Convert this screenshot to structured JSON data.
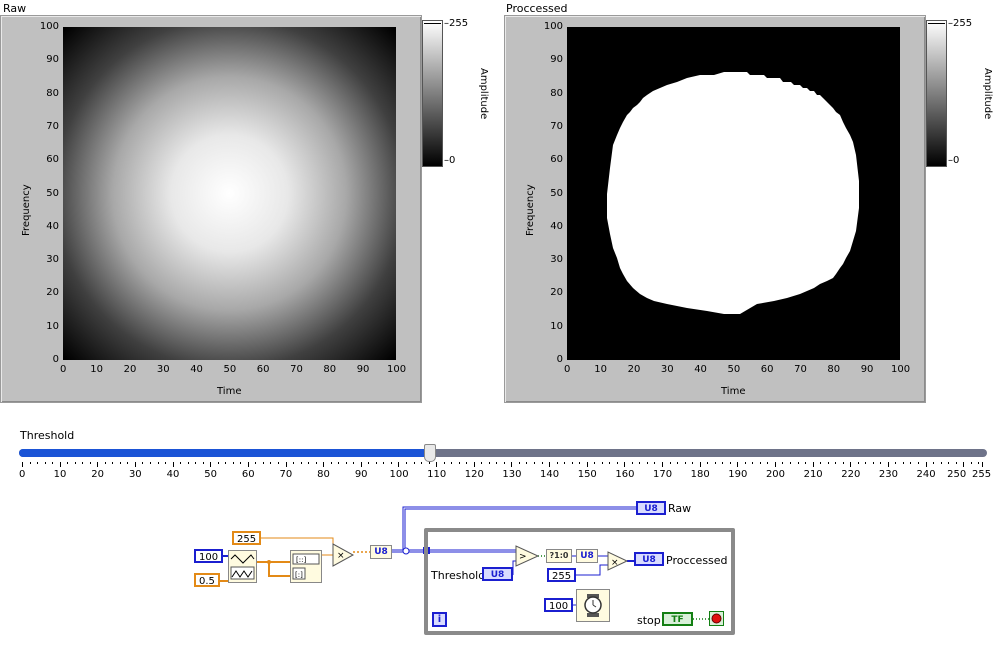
{
  "graphs": [
    {
      "title": "Raw",
      "x_axis_label": "Time",
      "y_axis_label": "Frequency",
      "x_ticks": [
        "0",
        "10",
        "20",
        "30",
        "40",
        "50",
        "60",
        "70",
        "80",
        "90",
        "100"
      ],
      "y_ticks": [
        "100",
        "90",
        "80",
        "70",
        "60",
        "50",
        "40",
        "30",
        "20",
        "10",
        "0"
      ],
      "colorbar_label": "Amplitude",
      "colorbar_max": "255",
      "colorbar_min": "0"
    },
    {
      "title": "Proccessed",
      "x_axis_label": "Time",
      "y_axis_label": "Frequency",
      "x_ticks": [
        "0",
        "10",
        "20",
        "30",
        "40",
        "50",
        "60",
        "70",
        "80",
        "90",
        "100"
      ],
      "y_ticks": [
        "100",
        "90",
        "80",
        "70",
        "60",
        "50",
        "40",
        "30",
        "20",
        "10",
        "0"
      ],
      "colorbar_label": "Amplitude",
      "colorbar_max": "255",
      "colorbar_min": "0"
    }
  ],
  "slider": {
    "label": "Threshold",
    "value": 108,
    "min": 0,
    "max": 255,
    "ticks": [
      "0",
      "10",
      "20",
      "30",
      "40",
      "50",
      "60",
      "70",
      "80",
      "90",
      "100",
      "110",
      "120",
      "130",
      "140",
      "150",
      "160",
      "170",
      "180",
      "190",
      "200",
      "210",
      "220",
      "230",
      "240",
      "250",
      "255"
    ]
  },
  "diagram": {
    "const_100_a": "100",
    "const_05": "0.5",
    "const_255_a": "255",
    "u8_convert": "U8",
    "raw_terminal": "U8",
    "raw_label": "Raw",
    "threshold_label": "Threshold",
    "threshold_terminal": "U8",
    "select_node": "?1:0",
    "u8_convert_2": "U8",
    "const_255_b": "255",
    "processed_terminal": "U8",
    "processed_label": "Proccessed",
    "const_100_b": "100",
    "stop_label": "stop",
    "stop_terminal": "TF",
    "iteration": "i"
  },
  "colors": {
    "slider_fill": "#1b54d6",
    "int_wire": "#1b1fd0",
    "dbl_wire": "#e38a17",
    "bool_wire": "#137f13"
  }
}
